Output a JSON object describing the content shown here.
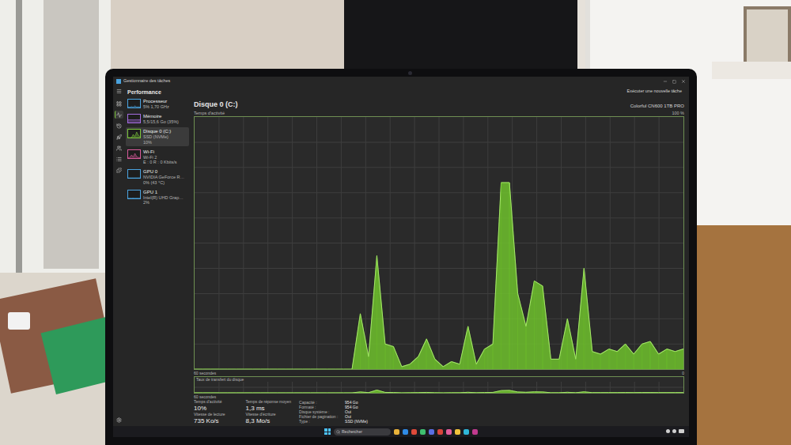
{
  "window": {
    "title": "Gestionnaire des tâches"
  },
  "header": {
    "title": "Performance",
    "action": "Exécuter une nouvelle tâche"
  },
  "nav": [
    {
      "selected": false
    },
    {
      "selected": true
    },
    {
      "selected": false
    },
    {
      "selected": false
    },
    {
      "selected": false
    },
    {
      "selected": false
    },
    {
      "selected": false
    }
  ],
  "sidebar": {
    "items": [
      {
        "name": "Processeur",
        "details": [
          "5% 1,70 GHz"
        ],
        "color": "#4aa3df",
        "selected": false,
        "spark": [
          8,
          5,
          12,
          6,
          20,
          7,
          9,
          5
        ]
      },
      {
        "name": "Mémoire",
        "details": [
          "5,5/15,6 Go (35%)"
        ],
        "color": "#a56de2",
        "selected": false,
        "spark": [
          34,
          35,
          35,
          34,
          35,
          36,
          35,
          35
        ]
      },
      {
        "name": "Disque 0 (C:)",
        "details": [
          "SSD (NVMe)",
          "10%"
        ],
        "color": "#7cc63c",
        "selected": true,
        "spark": [
          0,
          0,
          0,
          40,
          10,
          70,
          30,
          10
        ]
      },
      {
        "name": "Wi-Fi",
        "details": [
          "Wi-Fi 2",
          "E : 0 R : 0 Kbits/s"
        ],
        "color": "#d65a9a",
        "selected": false,
        "spark": [
          5,
          10,
          40,
          15,
          60,
          20,
          8,
          5
        ]
      },
      {
        "name": "GPU 0",
        "details": [
          "NVIDIA GeForce R…",
          "0% (43 °C)"
        ],
        "color": "#4aa3df",
        "selected": false,
        "spark": [
          0,
          0,
          0,
          0,
          0,
          0,
          0,
          0
        ]
      },
      {
        "name": "GPU 1",
        "details": [
          "Intel(R) UHD Grap…",
          "2%"
        ],
        "color": "#4aa3df",
        "selected": false,
        "spark": [
          2,
          3,
          2,
          4,
          2,
          3,
          2,
          2
        ]
      }
    ]
  },
  "disk": {
    "title": "Disque 0 (C:)",
    "model": "Colorful CN600 1TB PRO",
    "activity_chart": {
      "label": "Temps d'activité",
      "max_label": "100 %",
      "time_label": "60 secondes",
      "min_label": "0",
      "axis_max": 100,
      "values": [
        0,
        0,
        0,
        0,
        0,
        0,
        0,
        0,
        0,
        0,
        0,
        0,
        0,
        0,
        0,
        0,
        0,
        0,
        0,
        0,
        22,
        5,
        45,
        10,
        9,
        1,
        2,
        5,
        12,
        4,
        1,
        3,
        2,
        17,
        2,
        8,
        10,
        74,
        74,
        30,
        17,
        35,
        33,
        4,
        4,
        20,
        4,
        40,
        7,
        6,
        8,
        7,
        10,
        6,
        10,
        11,
        6,
        8,
        7,
        8
      ]
    },
    "transfer_chart": {
      "label": "Taux de transfert du disque",
      "time_label": "60 secondes",
      "axis_max": 100,
      "values": [
        0,
        0,
        0,
        0,
        0,
        0,
        0,
        0,
        0,
        0,
        0,
        0,
        0,
        0,
        0,
        0,
        0,
        0,
        0,
        0,
        8,
        2,
        25,
        4,
        3,
        0,
        1,
        2,
        4,
        1,
        0,
        1,
        1,
        5,
        1,
        3,
        4,
        20,
        22,
        8,
        5,
        9,
        8,
        1,
        1,
        5,
        1,
        9,
        2,
        2,
        2,
        2,
        3,
        2,
        3,
        3,
        2,
        2,
        2,
        2
      ]
    },
    "stats": [
      {
        "label": "Temps d'activité",
        "value": "10%"
      },
      {
        "label": "Temps de réponse moyen",
        "value": "1,3 ms"
      },
      {
        "label": "Vitesse de lecture",
        "value": "735 Ko/s"
      },
      {
        "label": "Vitesse d'écriture",
        "value": "8,3 Mo/s"
      }
    ],
    "properties": [
      {
        "label": "Capacité :",
        "value": "954 Go"
      },
      {
        "label": "Formaté :",
        "value": "954 Go"
      },
      {
        "label": "Disque système :",
        "value": "Oui"
      },
      {
        "label": "Fichier de pagination :",
        "value": "Oui"
      },
      {
        "label": "Type :",
        "value": "SSD (NVMe)"
      }
    ]
  },
  "taskbar": {
    "search": "Rechercher"
  }
}
